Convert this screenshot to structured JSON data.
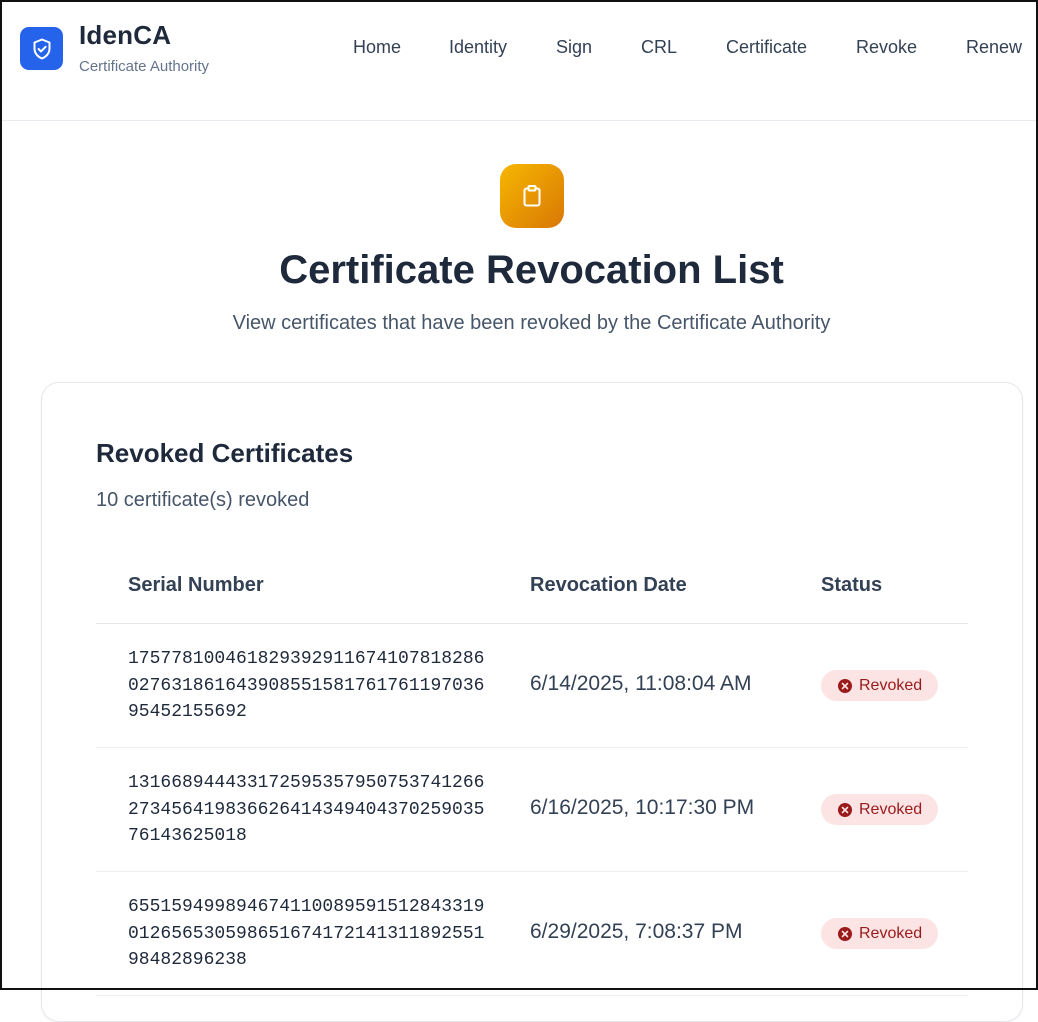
{
  "brand": {
    "name": "IdenCA",
    "subtitle": "Certificate Authority",
    "accent": "#2563eb",
    "icon": "shield-check-icon"
  },
  "nav": {
    "items": [
      "Home",
      "Identity",
      "Sign",
      "CRL",
      "Certificate",
      "Revoke",
      "Renew"
    ]
  },
  "hero": {
    "icon": "clipboard-icon",
    "title": "Certificate Revocation List",
    "subtitle": "View certificates that have been revoked by the Certificate Authority"
  },
  "card": {
    "title": "Revoked Certificates",
    "count_text": "10 certificate(s) revoked"
  },
  "table": {
    "columns": [
      "Serial Number",
      "Revocation Date",
      "Status"
    ],
    "rows": [
      {
        "serial": "17577810046182939291167410781828602763186164390855158176176119703695452155692",
        "date": "6/14/2025, 11:08:04 AM",
        "status": "Revoked"
      },
      {
        "serial": "13166894443317259535795075374126627345641983662641434940437025903576143625018",
        "date": "6/16/2025, 10:17:30 PM",
        "status": "Revoked"
      },
      {
        "serial": "65515949989467411008959151284331901265653059865167417214131189255198482896238",
        "date": "6/29/2025, 7:08:37 PM",
        "status": "Revoked"
      }
    ]
  },
  "colors": {
    "revoked_bg": "#fde4e4",
    "revoked_text": "#991b1b",
    "hero_gradient": [
      "#f6b700",
      "#d97706"
    ]
  }
}
